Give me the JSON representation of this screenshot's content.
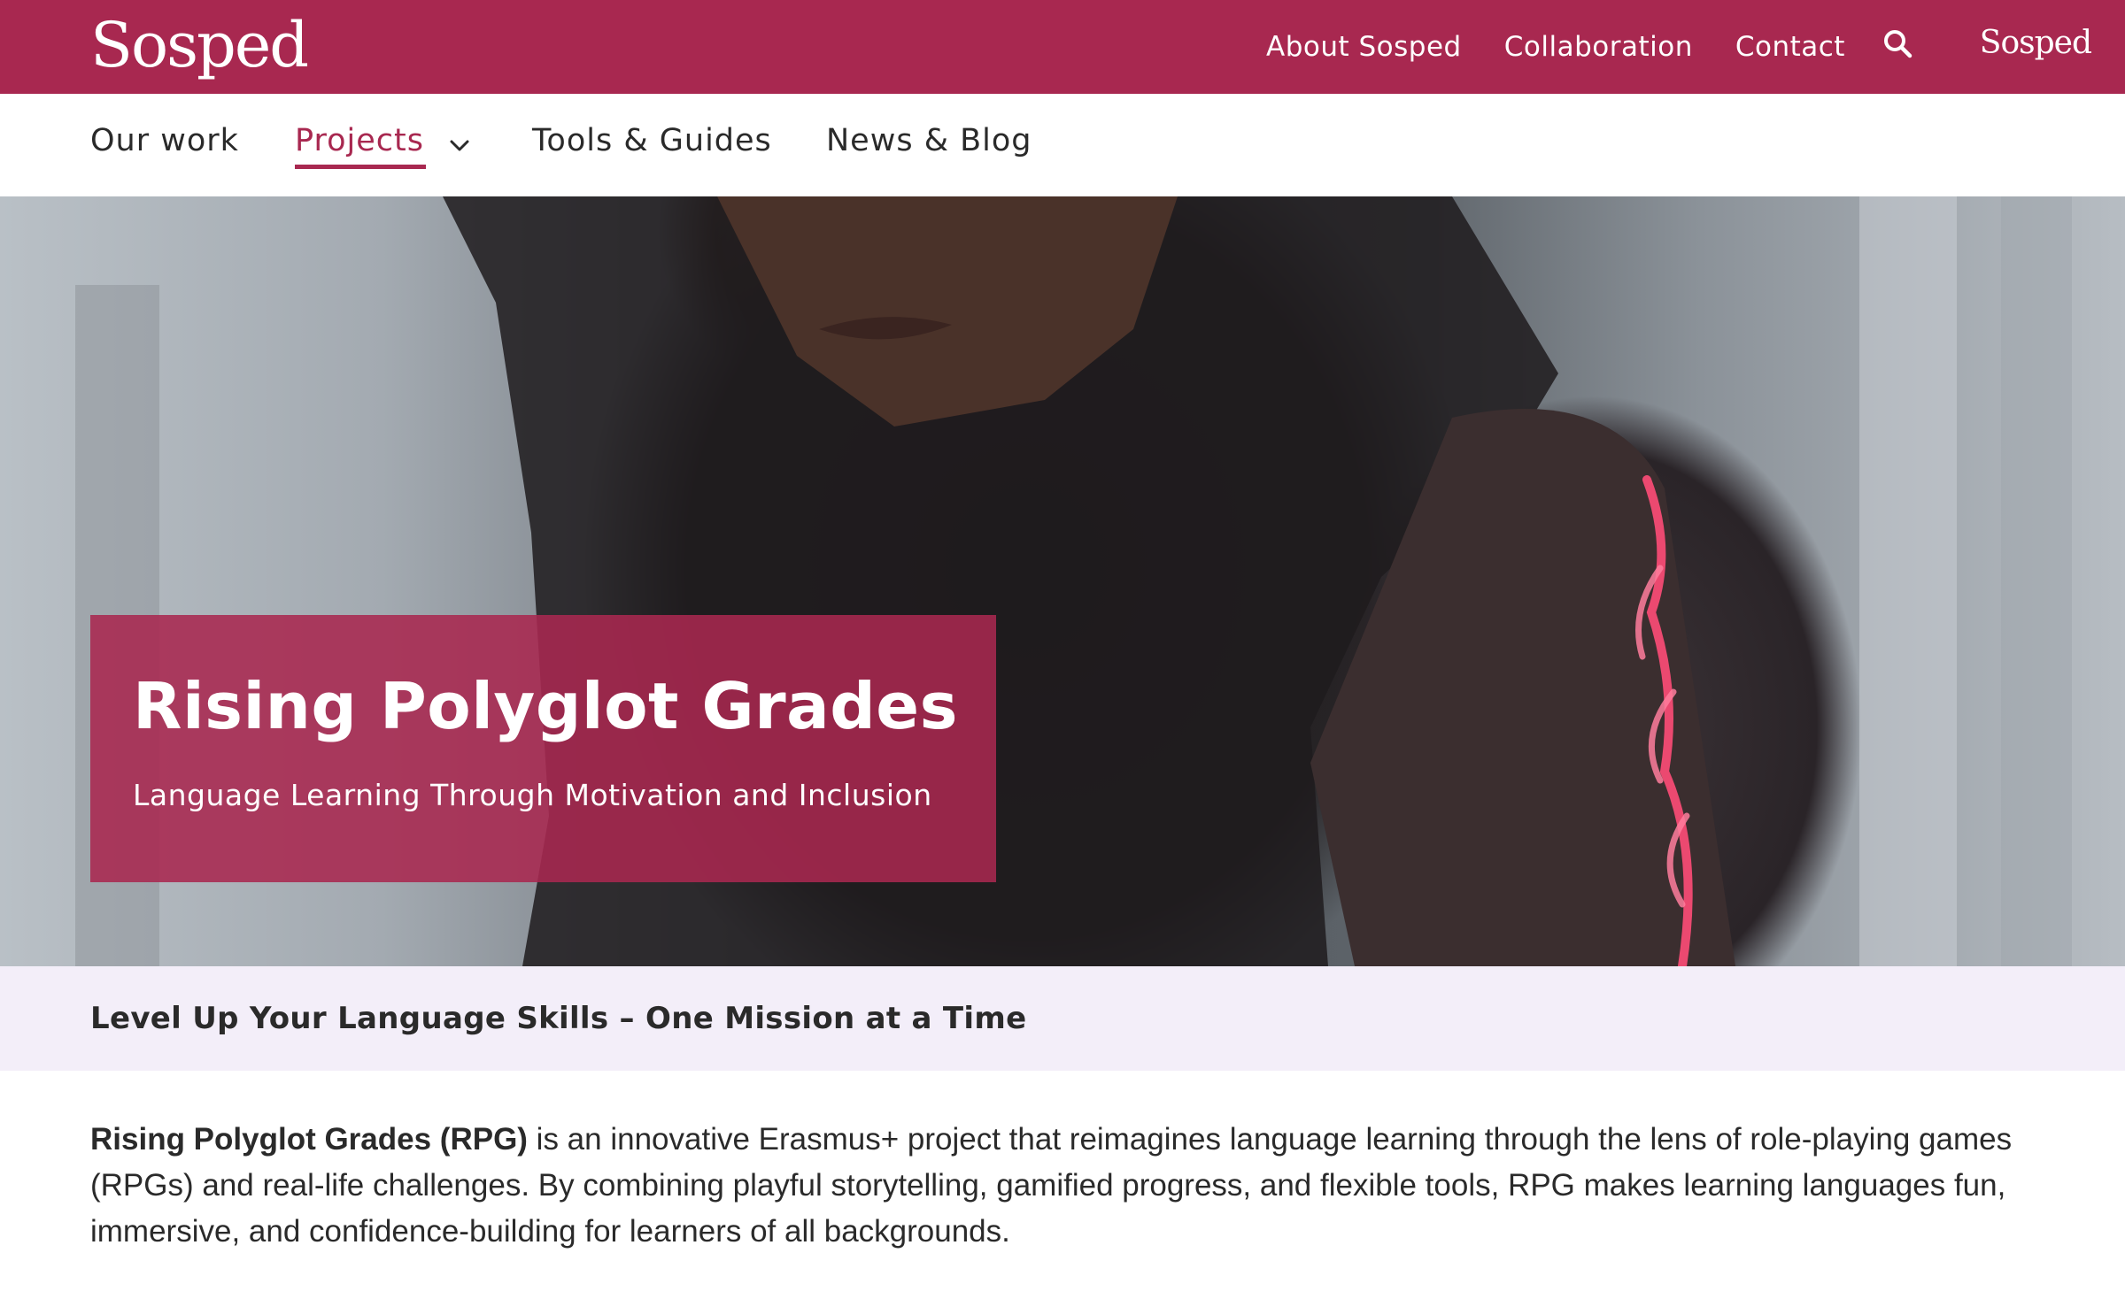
{
  "header": {
    "logo": "Sosped",
    "logo_small": "Sosped",
    "nav": [
      "About Sosped",
      "Collaboration",
      "Contact"
    ],
    "search_icon": "search-icon"
  },
  "subnav": {
    "items": [
      "Our work",
      "Projects",
      "Tools & Guides",
      "News & Blog"
    ],
    "active": "Projects",
    "dropdown_icon": "chevron-down-icon"
  },
  "hero": {
    "title": "Rising Polyglot Grades",
    "subtitle": "Language Learning Through Motivation and Inclusion"
  },
  "band": {
    "heading": "Level Up Your Language Skills – One Mission at a Time"
  },
  "intro": {
    "bold": "Rising Polyglot Grades (RPG)",
    "text": " is an innovative Erasmus+ project that reimagines language learning through the lens of role-playing games (RPGs) and real-life challenges. By combining playful storytelling, gamified progress, and flexible tools, RPG makes learning languages fun, immersive, and confidence-building for learners of all backgrounds."
  },
  "colors": {
    "brand": "#a82850",
    "band_bg": "#f3eef9"
  }
}
